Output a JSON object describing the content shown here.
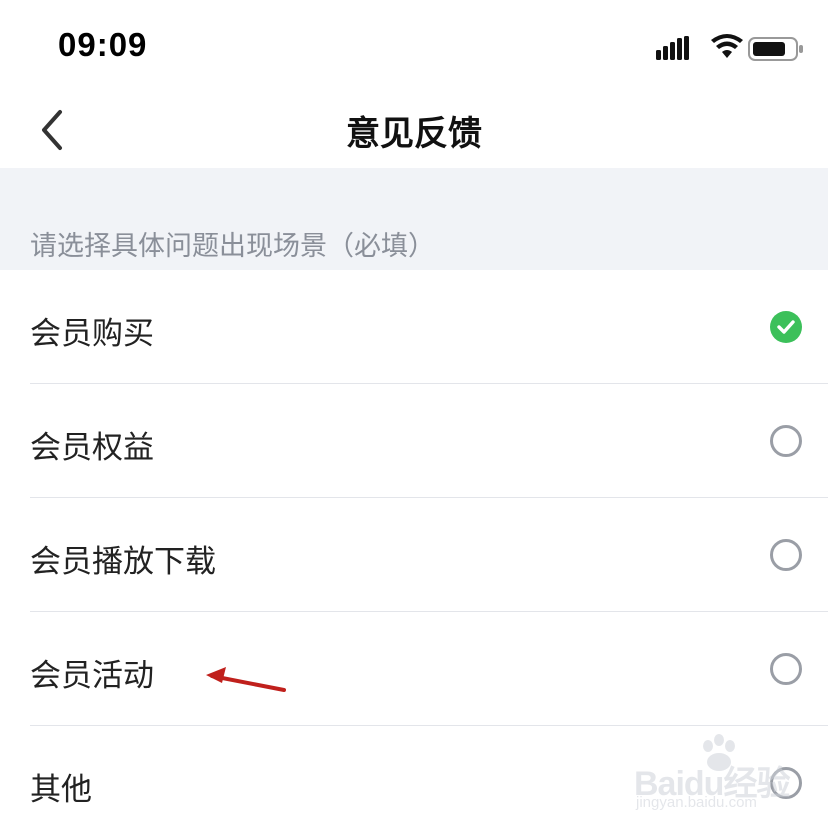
{
  "status_bar": {
    "time": "09:09",
    "icons": [
      "signal-icon",
      "wifi-icon",
      "battery-icon"
    ]
  },
  "nav": {
    "back_icon": "chevron-left-icon",
    "title": "意见反馈"
  },
  "section": {
    "label": "请选择具体问题出现场景（必填）"
  },
  "options": [
    {
      "label": "会员购买",
      "selected": true
    },
    {
      "label": "会员权益",
      "selected": false
    },
    {
      "label": "会员播放下载",
      "selected": false
    },
    {
      "label": "会员活动",
      "selected": false
    },
    {
      "label": "其他",
      "selected": false
    }
  ],
  "colors": {
    "accent_green": "#3cc05a",
    "section_bg": "#f1f3f7",
    "annotation_red": "#c0201c"
  },
  "watermark": {
    "brand": "Baidu经验",
    "url": "jingyan.baidu.com"
  }
}
